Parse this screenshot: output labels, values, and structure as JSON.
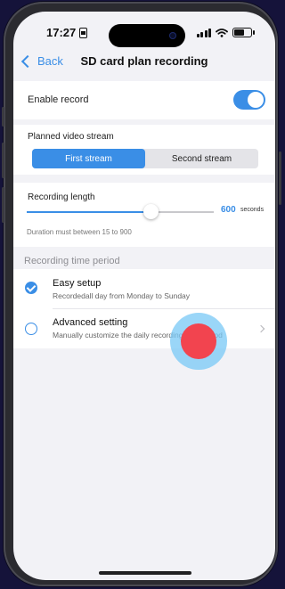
{
  "status_bar": {
    "time": "17:27"
  },
  "nav": {
    "back_label": "Back",
    "title": "SD card plan recording"
  },
  "enable_record": {
    "label": "Enable record",
    "on": true
  },
  "stream": {
    "label": "Planned video stream",
    "options": [
      "First stream",
      "Second stream"
    ],
    "selected": "First stream"
  },
  "recording_length": {
    "label": "Recording length",
    "value": "600",
    "unit": "seconds",
    "min": 15,
    "max": 900,
    "hint": "Duration must between 15 to 900"
  },
  "time_period": {
    "header": "Recording time period",
    "options": [
      {
        "title": "Easy setup",
        "subtitle": "Recordedall day from Monday to Sunday",
        "selected": true
      },
      {
        "title": "Advanced setting",
        "subtitle": "Manually customize the daily recording time period",
        "selected": false
      }
    ]
  },
  "colors": {
    "accent": "#3a8ee6",
    "touch_dot": "#f2444f",
    "touch_ring": "#78c8f5"
  }
}
